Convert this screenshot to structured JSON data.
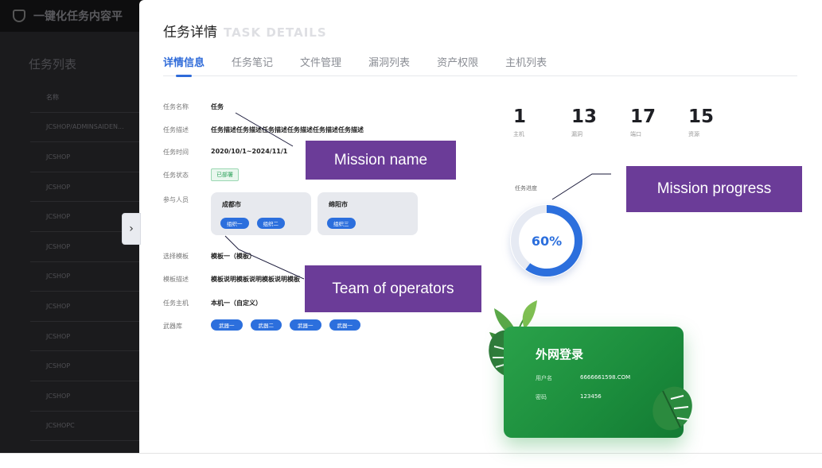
{
  "background_app": {
    "title": "一键化任务内容平",
    "list_title": "任务列表",
    "rows": [
      "名称",
      "JCSHOP/ADMINSAIDEN...",
      "JCSHOP",
      "JCSHOP",
      "JCSHOP",
      "JCSHOP",
      "JCSHOP",
      "JCSHOP",
      "JCSHOP",
      "JCSHOP",
      "JCSHOP",
      "JCSHOPC"
    ]
  },
  "drawer": {
    "toggle_glyph": "›",
    "title_cn": "任务详情",
    "title_en": "TASK DETAILS",
    "tabs": [
      "详情信息",
      "任务笔记",
      "文件管理",
      "漏洞列表",
      "资产权限",
      "主机列表"
    ],
    "form": {
      "name_label": "任务名称",
      "name_value": "任务",
      "desc_label": "任务描述",
      "desc_value": "任务描述任务描述任务描述任务描述任务描述任务描述",
      "time_label": "任务时间",
      "time_value": "2020/10/1~2024/11/1",
      "status_label": "任务状态",
      "status_value": "已部署",
      "members_label": "参与人员",
      "teams": [
        {
          "city": "成都市",
          "members": [
            "组织一",
            "组织二"
          ]
        },
        {
          "city": "绵阳市",
          "members": [
            "组织三"
          ]
        }
      ],
      "template_label": "选择模板",
      "template_value": "模板一（模板）",
      "template_desc_label": "模板描述",
      "template_desc_value": "模板说明模板说明模板说明模板",
      "host_label": "任务主机",
      "host_value": "本机一（自定义）",
      "weapons_label": "武器库",
      "weapons": [
        "武器一",
        "武器二",
        "武器一",
        "武器一"
      ]
    },
    "stats": [
      {
        "value": "1",
        "label": "主机"
      },
      {
        "value": "13",
        "label": "漏洞"
      },
      {
        "value": "17",
        "label": "端口"
      },
      {
        "value": "15",
        "label": "资源"
      }
    ],
    "progress": {
      "label": "任务进度",
      "percent": 60,
      "text": "60%",
      "color": "#2c6fdd",
      "track_color": "#e6eaf3"
    },
    "login_card": {
      "title": "外网登录",
      "user_label": "用户名",
      "user_value": "6666661598.COM",
      "pass_label": "密码",
      "pass_value": "123456"
    }
  },
  "annotations": {
    "mission_name": "Mission name",
    "mission_progress": "Mission progress",
    "team_of_operators": "Team of operators",
    "color": "#6b3c98"
  }
}
